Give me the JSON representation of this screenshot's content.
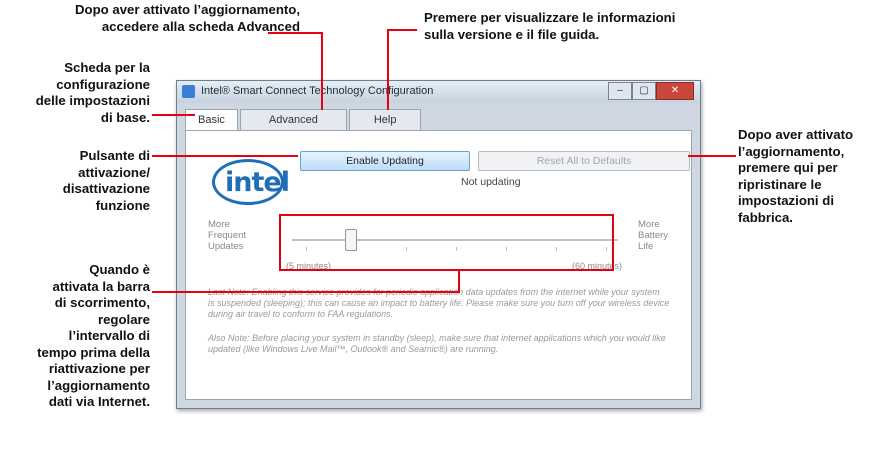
{
  "callouts": {
    "advanced_tab": [
      "Dopo aver attivato l’aggiornamento,",
      "accedere alla scheda Advanced"
    ],
    "help_tab": [
      "Premere per visualizzare le informazioni",
      "sulla versione e il file guida."
    ],
    "basic_tab": [
      "Scheda per la",
      "configurazione",
      "delle impostazioni",
      "di base."
    ],
    "enable_button": [
      "Pulsante di",
      "attivazione/",
      "disattivazione",
      "funzione"
    ],
    "slider": [
      "Quando è",
      "attivata la barra",
      "di scorrimento,",
      "regolare",
      "l’intervallo di",
      "tempo prima della",
      "riattivazione per",
      "l’aggiornamento",
      "dati via Internet."
    ],
    "reset_button": [
      "Dopo aver attivato",
      "l’aggiornamento,",
      "premere qui per",
      "ripristinare le",
      "impostazioni di",
      "fabbrica."
    ]
  },
  "window": {
    "title": "Intel® Smart Connect Technology Configuration",
    "controls": {
      "minimize": "–",
      "maximize": "▢",
      "close": "✕"
    }
  },
  "tabs": {
    "basic": "Basic",
    "advanced": "Advanced",
    "help": "Help"
  },
  "basic_panel": {
    "logo_text": "intel",
    "enable_button": "Enable Updating",
    "reset_button": "Reset All to Defaults",
    "status": "Not updating",
    "left_label": [
      "More",
      "Frequent",
      "Updates"
    ],
    "right_label": [
      "More",
      "Battery",
      "Life"
    ],
    "slider_min_label": "(5 minutes)",
    "slider_max_label": "(60 minutes)",
    "slider_value_fraction": 0.18,
    "note_1": [
      "Last Note: Enabling this service provides for periodic application data updates from the internet while your system",
      "is suspended (sleeping); this can cause an impact to battery life. Please make sure you turn off your wireless device",
      "during air travel to conform to FAA regulations."
    ],
    "note_2": [
      "Also Note: Before placing your system in standby (sleep), make sure that internet applications which you would like",
      "updated (like Windows Live Mail™, Outlook® and Seamic®) are running."
    ]
  },
  "colors": {
    "annotation_line": "#e60012",
    "intel_blue": "#1e6fb8"
  }
}
